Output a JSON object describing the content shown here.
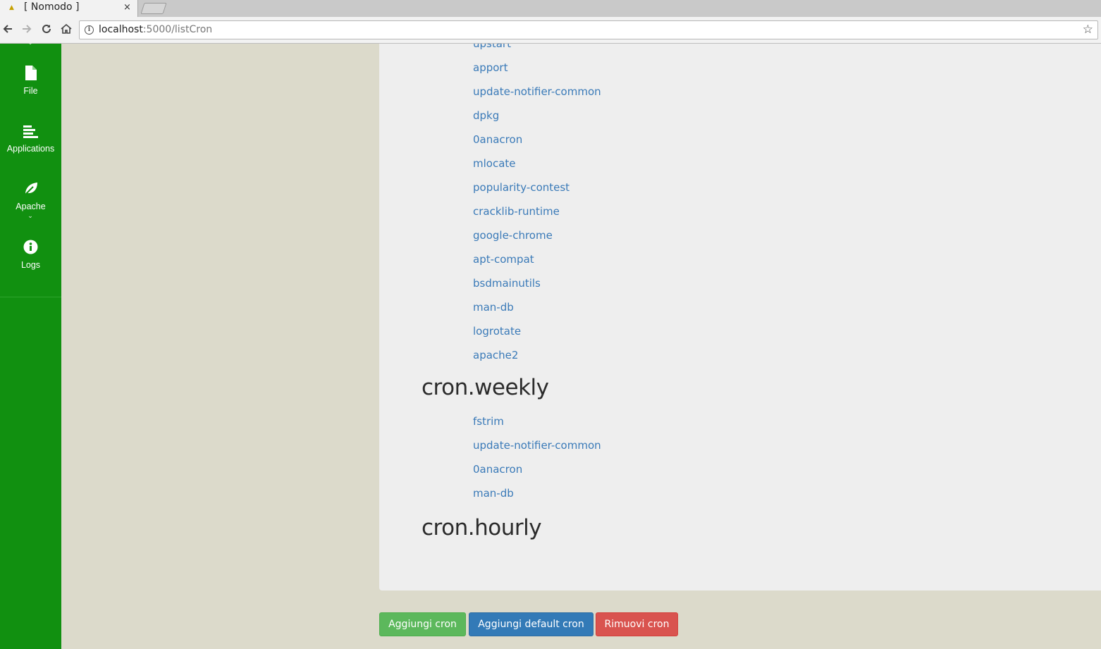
{
  "browser": {
    "tab_title": "[ Nomodo ]",
    "tab_close": "×",
    "url_host": "localhost",
    "url_rest": ":5000/listCron"
  },
  "sidebar": {
    "items": [
      {
        "label": "File",
        "icon": "file-icon"
      },
      {
        "label": "Applications",
        "icon": "applications-icon"
      },
      {
        "label": "Apache",
        "icon": "leaf-icon"
      },
      {
        "label": "Logs",
        "icon": "info-circle-icon"
      }
    ]
  },
  "cron_daily": {
    "partial_item": "upstart",
    "items": [
      "apport",
      "update-notifier-common",
      "dpkg",
      "0anacron",
      "mlocate",
      "popularity-contest",
      "cracklib-runtime",
      "google-chrome",
      "apt-compat",
      "bsdmainutils",
      "man-db",
      "logrotate",
      "apache2"
    ]
  },
  "cron_weekly": {
    "title": "cron.weekly",
    "items": [
      "fstrim",
      "update-notifier-common",
      "0anacron",
      "man-db"
    ]
  },
  "cron_hourly": {
    "title": "cron.hourly"
  },
  "actions": {
    "add_cron": "Aggiungi cron",
    "add_default_cron": "Aggiungi default cron",
    "remove_cron": "Rimuovi cron"
  },
  "colors": {
    "sidebar": "#119010",
    "link": "#3a7ab8",
    "btn_green": "#5cb85c",
    "btn_blue": "#337ab7",
    "btn_red": "#d9534f"
  }
}
